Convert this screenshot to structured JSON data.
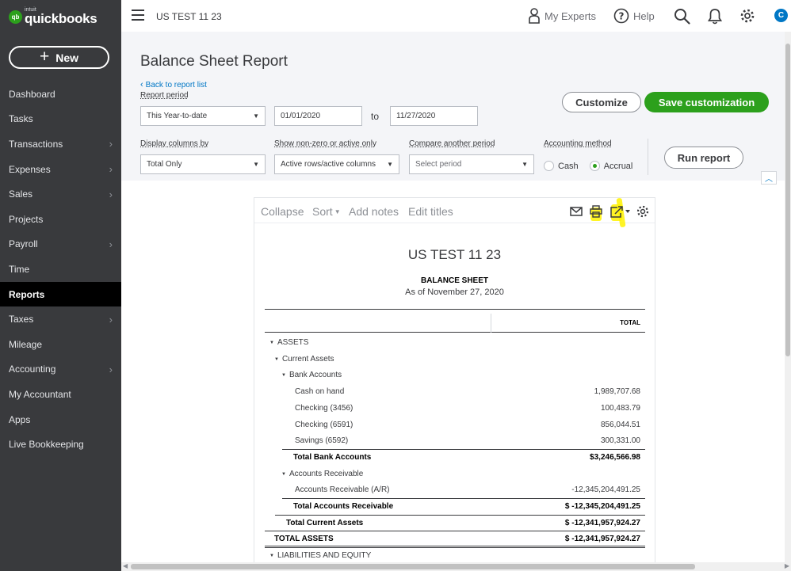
{
  "brand": {
    "badge": "qb",
    "intuit": "intuit",
    "name": "quickbooks"
  },
  "sidebar": {
    "new_label": "New",
    "items": [
      {
        "label": "Dashboard",
        "chevron": false
      },
      {
        "label": "Tasks",
        "chevron": false
      },
      {
        "label": "Transactions",
        "chevron": true
      },
      {
        "label": "Expenses",
        "chevron": true
      },
      {
        "label": "Sales",
        "chevron": true
      },
      {
        "label": "Projects",
        "chevron": false
      },
      {
        "label": "Payroll",
        "chevron": true
      },
      {
        "label": "Time",
        "chevron": false
      },
      {
        "label": "Reports",
        "chevron": false,
        "active": true
      },
      {
        "label": "Taxes",
        "chevron": true
      },
      {
        "label": "Mileage",
        "chevron": false
      },
      {
        "label": "Accounting",
        "chevron": true
      },
      {
        "label": "My Accountant",
        "chevron": false
      },
      {
        "label": "Apps",
        "chevron": false
      },
      {
        "label": "Live Bookkeeping",
        "chevron": false
      }
    ]
  },
  "topbar": {
    "company": "US TEST 11 23",
    "my_experts": "My Experts",
    "help": "Help",
    "avatar_initial": "C"
  },
  "header": {
    "title": "Balance Sheet Report",
    "back_link": "Back to report list",
    "report_period_label": "Report period",
    "report_period_value": "This Year-to-date",
    "date_from": "01/01/2020",
    "to_label": "to",
    "date_to": "11/27/2020",
    "customize_label": "Customize",
    "save_customization_label": "Save customization",
    "display_columns_label": "Display columns by",
    "display_columns_value": "Total Only",
    "show_nonzero_label": "Show non-zero or active only",
    "show_nonzero_value": "Active rows/active columns",
    "compare_label": "Compare another period",
    "compare_placeholder": "Select period",
    "accounting_method_label": "Accounting method",
    "method_cash": "Cash",
    "method_accrual": "Accrual",
    "method_selected": "Accrual",
    "run_report_label": "Run report"
  },
  "report_toolbar": {
    "collapse": "Collapse",
    "sort": "Sort",
    "add_notes": "Add notes",
    "edit_titles": "Edit titles"
  },
  "report": {
    "company": "US TEST 11 23",
    "title": "BALANCE SHEET",
    "subtitle": "As of November 27, 2020",
    "column_header": "TOTAL",
    "rows": [
      {
        "label": "ASSETS",
        "value": "",
        "indent": 0,
        "caret": true,
        "total": false
      },
      {
        "label": "Current Assets",
        "value": "",
        "indent": 1,
        "caret": true,
        "total": false
      },
      {
        "label": "Bank Accounts",
        "value": "",
        "indent": 2,
        "caret": true,
        "total": false
      },
      {
        "label": "Cash on hand",
        "value": "1,989,707.68",
        "indent": 3,
        "caret": false,
        "total": false
      },
      {
        "label": "Checking (3456)",
        "value": "100,483.79",
        "indent": 3,
        "caret": false,
        "total": false
      },
      {
        "label": "Checking (6591)",
        "value": "856,044.51",
        "indent": 3,
        "caret": false,
        "total": false
      },
      {
        "label": "Savings (6592)",
        "value": "300,331.00",
        "indent": 3,
        "caret": false,
        "total": false
      },
      {
        "label": "Total Bank Accounts",
        "value": "$3,246,566.98",
        "indent": 2,
        "caret": false,
        "total": true
      },
      {
        "label": "Accounts Receivable",
        "value": "",
        "indent": 2,
        "caret": true,
        "total": false
      },
      {
        "label": "Accounts Receivable (A/R)",
        "value": "-12,345,204,491.25",
        "indent": 3,
        "caret": false,
        "total": false
      },
      {
        "label": "Total Accounts Receivable",
        "value": "$ -12,345,204,491.25",
        "indent": 2,
        "caret": false,
        "total": true
      },
      {
        "label": "Total Current Assets",
        "value": "$ -12,341,957,924.27",
        "indent": 1,
        "caret": false,
        "total": true
      },
      {
        "label": "TOTAL ASSETS",
        "value": "$ -12,341,957,924.27",
        "indent": 0,
        "caret": false,
        "total": true,
        "grand": true
      },
      {
        "label": "LIABILITIES AND EQUITY",
        "value": "",
        "indent": 0,
        "caret": true,
        "total": false
      }
    ]
  },
  "colors": {
    "sidebar_bg": "#393a3d",
    "brand_green": "#2ca01c",
    "link_blue": "#0077c5",
    "highlight_yellow": "#fff200"
  },
  "icons": [
    "hamburger-icon",
    "person-icon",
    "help-icon",
    "search-icon",
    "bell-icon",
    "gear-icon",
    "email-icon",
    "print-icon",
    "export-icon",
    "settings-icon"
  ]
}
